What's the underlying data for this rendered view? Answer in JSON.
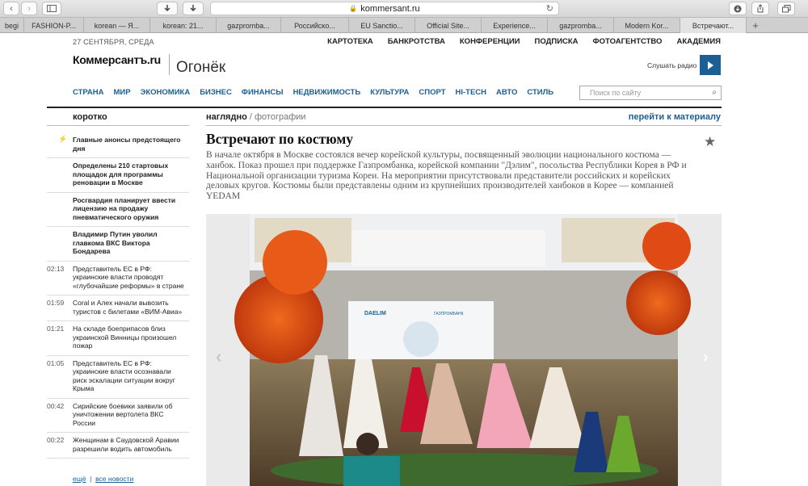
{
  "browser": {
    "url": "kommersant.ru",
    "tabs": [
      {
        "label": "begi"
      },
      {
        "label": "FASHION-P..."
      },
      {
        "label": "korean — Я..."
      },
      {
        "label": "korean: 21..."
      },
      {
        "label": "gazpromba..."
      },
      {
        "label": "Российско..."
      },
      {
        "label": "EU Sanctio..."
      },
      {
        "label": "Official Site..."
      },
      {
        "label": "Experience..."
      },
      {
        "label": "gazpromba..."
      },
      {
        "label": "Modern Kor..."
      },
      {
        "label": "Встречают..."
      }
    ],
    "active_tab": 11
  },
  "header": {
    "date": "27 СЕНТЯБРЯ, СРЕДА",
    "top_nav": [
      "КАРТОТЕКА",
      "БАНКРОТСТВА",
      "КОНФЕРЕНЦИИ",
      "ПОДПИСКА",
      "ФОТОАГЕНТСТВО",
      "АКАДЕМИЯ"
    ],
    "logo": "Коммерсантъ.ru",
    "sub_brand": "Огонёк",
    "radio_label": "Слушать радио",
    "sections": [
      "СТРАНА",
      "МИР",
      "ЭКОНОМИКА",
      "БИЗНЕС",
      "ФИНАНСЫ",
      "НЕДВИЖИМОСТЬ",
      "КУЛЬТУРА",
      "СПОРТ",
      "HI-TECH",
      "АВТО",
      "СТИЛЬ"
    ],
    "search_placeholder": "Поиск по сайту"
  },
  "sidebar": {
    "title": "коротко",
    "items": [
      {
        "time": "",
        "text": "Главные анонсы предстоящего дня",
        "bold": true,
        "flash": true
      },
      {
        "time": "",
        "text": "Определены 210 стартовых площадок для программы реновации в Москве",
        "bold": true
      },
      {
        "time": "",
        "text": "Росгвардия планирует ввести лицензию на продажу пневматического оружия",
        "bold": true
      },
      {
        "time": "",
        "text": "Владимир Путин уволил главкома ВКС Виктора Бондарева",
        "bold": true
      },
      {
        "time": "02:13",
        "text": "Представитель ЕС в РФ: украинские власти проводят «глубочайшие реформы» в стране",
        "bold": false
      },
      {
        "time": "01:59",
        "text": "Coral и Алех начали вывозить туристов с билетами «ВИМ-Авиа»",
        "bold": false
      },
      {
        "time": "01:21",
        "text": "На складе боеприпасов близ украинской Винницы произошел пожар",
        "bold": false
      },
      {
        "time": "01:05",
        "text": "Представитель ЕС в РФ: украинские власти осознавали риск эскалации ситуации вокруг Крыма",
        "bold": false
      },
      {
        "time": "00:42",
        "text": "Сирийские боевики заявили об уничтожении вертолета ВКС России",
        "bold": false
      },
      {
        "time": "00:22",
        "text": "Женщинам в Саудовской Аравии разрешили водить автомобиль",
        "bold": false
      }
    ],
    "more": "ещё",
    "all_news": "все новости"
  },
  "article": {
    "crumb_section": "наглядно",
    "crumb_sub": "фотографии",
    "goto_label": "перейти к материалу",
    "title": "Встречают по костюму",
    "lead": "В начале октября в Москве состоялся вечер корейской культуры, посвященный эволюции национального костюма — ханбок. Показ прошел при поддержке Газпромбанка, корейской компании \"Дэлим\", посольства Республики Корея в РФ и Национальной организации туризма Кореи. На мероприятии присутствовали представители российских и корейских деловых кругов. Костюмы были представлены одним из крупнейших производителей ханбоков в Корее — компанией YEDAM",
    "photo_screen_left": "DAELIM",
    "photo_screen_right": "ГАЗПРОМБАНК"
  },
  "colors": {
    "accent": "#1b5f95",
    "text": "#222222"
  }
}
